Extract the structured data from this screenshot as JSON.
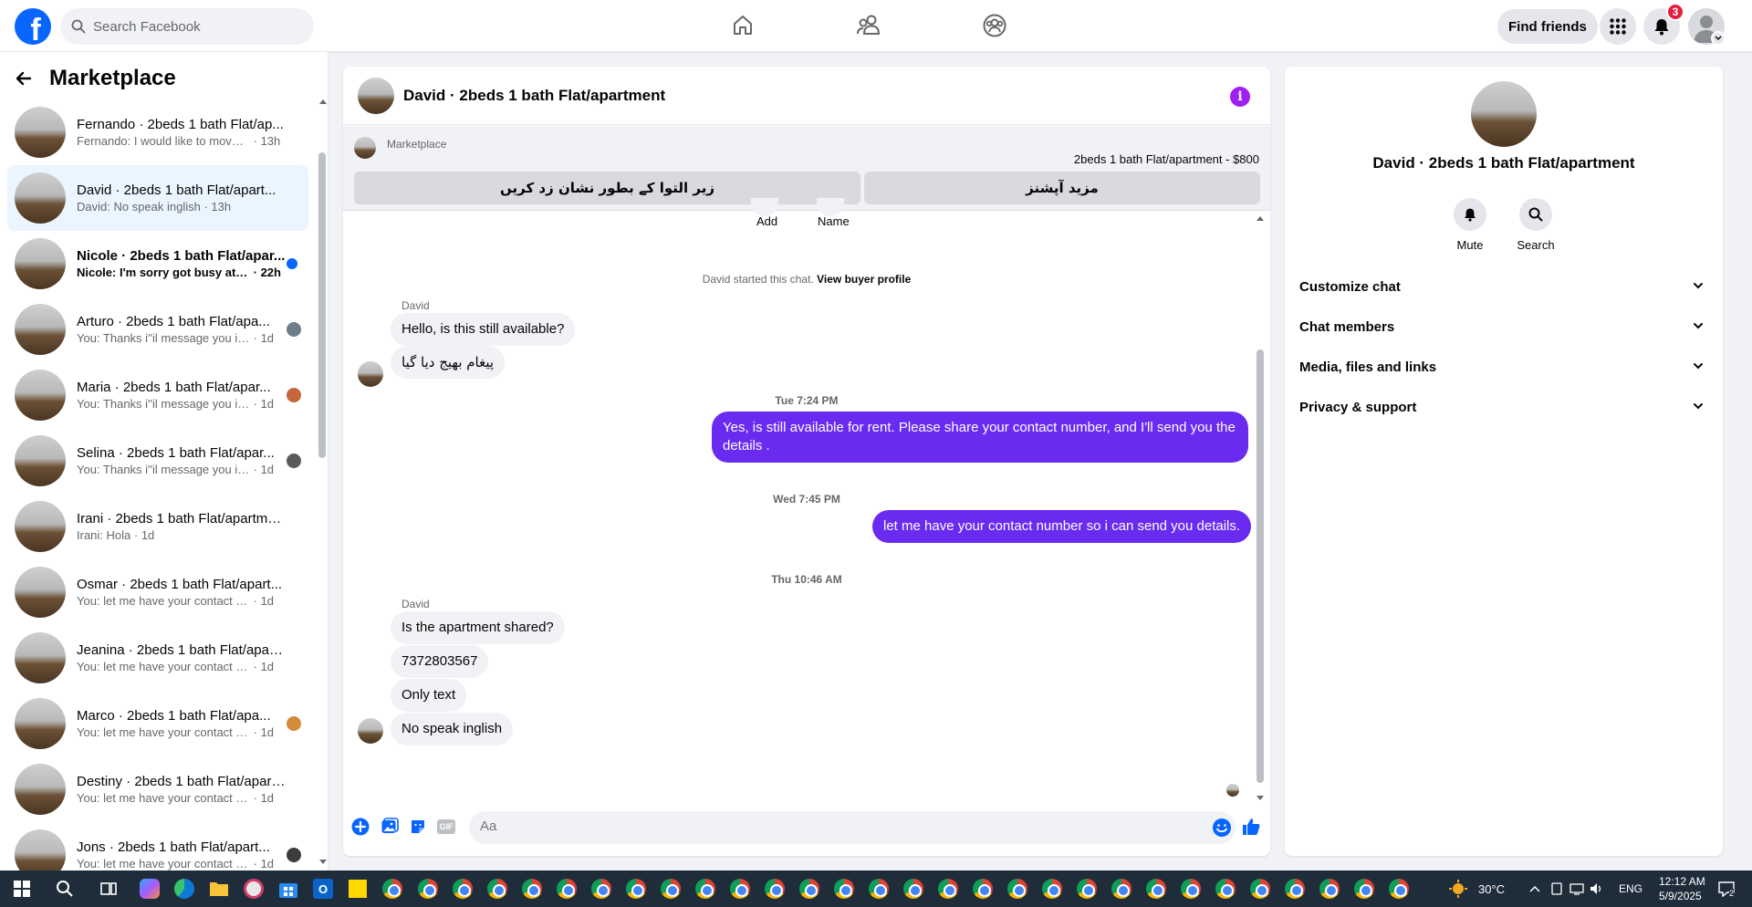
{
  "topbar": {
    "search_placeholder": "Search Facebook",
    "find_friends_label": "Find friends",
    "notification_count": "3"
  },
  "sidebar": {
    "title": "Marketplace",
    "conversations": [
      {
        "name": "Fernando · 2beds 1 bath Flat/ap...",
        "preview": "Fernando: I would like to move in ...",
        "time": "13h"
      },
      {
        "name": "David · 2beds 1 bath Flat/apart...",
        "preview": "David: No speak inglish",
        "time": "13h"
      },
      {
        "name": "Nicole · 2beds 1 bath Flat/apar...",
        "preview": "Nicole: I'm sorry got busy at w...",
        "time": "22h"
      },
      {
        "name": "Arturo · 2beds 1 bath Flat/apa...",
        "preview": "You: Thanks i''il message you in ...",
        "time": "1d"
      },
      {
        "name": "Maria · 2beds 1 bath Flat/apar...",
        "preview": "You: Thanks i''il message you in ...",
        "time": "1d"
      },
      {
        "name": "Selina · 2beds 1 bath Flat/apar...",
        "preview": "You: Thanks i''il message you in ...",
        "time": "1d"
      },
      {
        "name": "Irani · 2beds 1 bath Flat/apartme...",
        "preview": "Irani: Hola",
        "time": "1d"
      },
      {
        "name": "Osmar · 2beds 1 bath Flat/apart...",
        "preview": "You: let me have your contact num...",
        "time": "1d"
      },
      {
        "name": "Jeanina · 2beds 1 bath Flat/apart...",
        "preview": "You: let me have your contact num...",
        "time": "1d"
      },
      {
        "name": "Marco · 2beds 1 bath Flat/apa...",
        "preview": "You: let me have your contact n...",
        "time": "1d"
      },
      {
        "name": "Destiny · 2beds 1 bath Flat/apart...",
        "preview": "You: let me have your contact num...",
        "time": "1d"
      },
      {
        "name": "Jons · 2beds 1 bath Flat/apart...",
        "preview": "You: let me have your contact n...",
        "time": "1d"
      }
    ]
  },
  "chat": {
    "title": "David · 2beds 1 bath Flat/apartment",
    "marketplace_label": "Marketplace",
    "listing_price": "2beds 1 bath Flat/apartment - $800",
    "btn_mark_pending": "زیر التوا کے بطور نشان زد کریں",
    "btn_more_options": "مزید آپشنز",
    "peek_add": "Add",
    "peek_name": "Name",
    "started_text": "David started this chat.",
    "view_profile": "View buyer profile",
    "sender_name": "David",
    "msg_1": "Hello, is this still available?",
    "msg_2": "پیغام بھیج دیا گیا",
    "ts_1": "Tue 7:24 PM",
    "msg_3": "Yes, is still available for rent. Please share your contact number, and I'll send you the details .",
    "ts_2": "Wed 7:45 PM",
    "msg_4": "let me have your contact number so i can send you details.",
    "ts_3": "Thu 10:46 AM",
    "msg_5": "Is the apartment shared?",
    "msg_6": "7372803567",
    "msg_7": "Only text",
    "msg_8": "No speak inglish",
    "composer_placeholder": "Aa",
    "gif_label": "GIF"
  },
  "info": {
    "name": "David · 2beds 1 bath Flat/apartment",
    "mute_label": "Mute",
    "search_label": "Search",
    "sections": [
      "Customize chat",
      "Chat members",
      "Media, files and links",
      "Privacy & support"
    ]
  },
  "taskbar": {
    "temperature": "30°C",
    "language": "ENG",
    "time": "12:12 AM",
    "date": "5/9/2025",
    "notif_count": "2"
  },
  "colors": {
    "brand": "#0866ff",
    "outgoing_bubble": "#6a2bf1",
    "info_icon": "#a020f0"
  }
}
